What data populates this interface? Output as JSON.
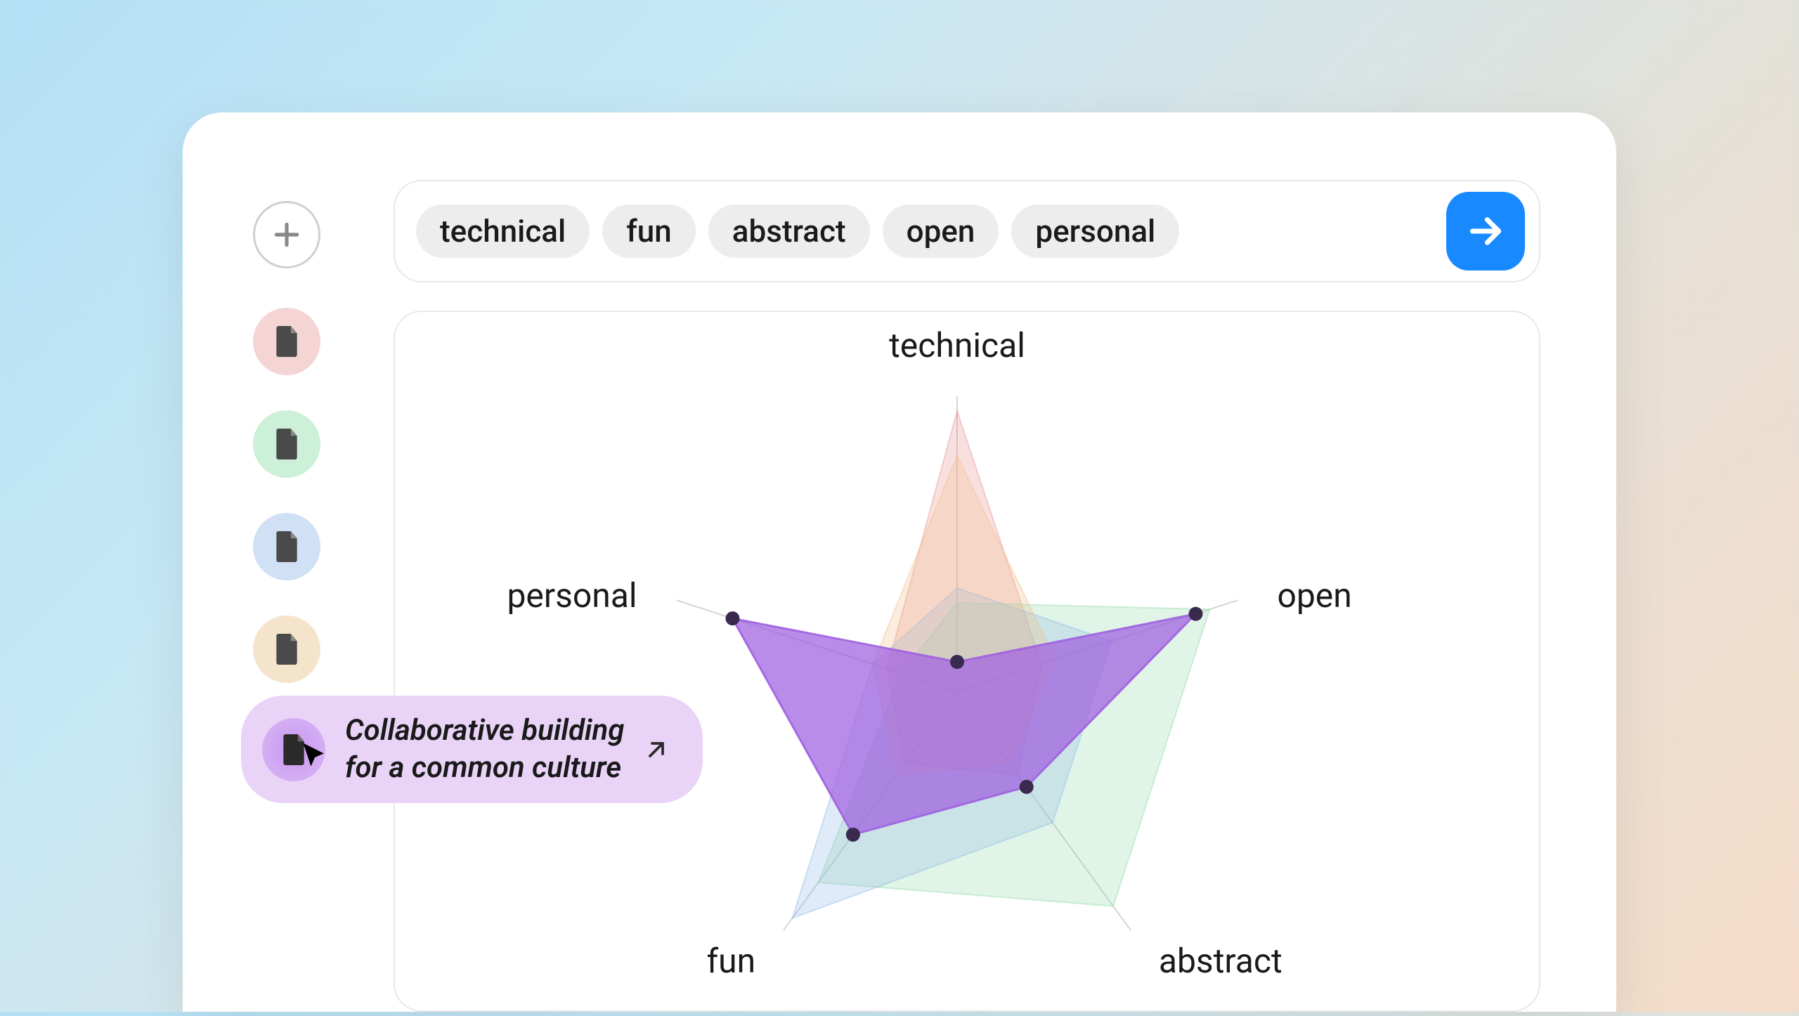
{
  "toolbar": {
    "tags": [
      "technical",
      "fun",
      "abstract",
      "open",
      "personal"
    ]
  },
  "sidebar": {
    "items": [
      {
        "color": "#f5d4d4"
      },
      {
        "color": "#cdf0d9"
      },
      {
        "color": "#d0e0f5"
      },
      {
        "color": "#f5e4cc"
      },
      {
        "color": "#c896f0"
      }
    ],
    "selected_index": 4,
    "tooltip_text": "Collaborative building\nfor a common culture"
  },
  "chart_data": {
    "type": "radar",
    "axes": [
      "technical",
      "open",
      "abstract",
      "fun",
      "personal"
    ],
    "range": [
      0,
      1
    ],
    "series": [
      {
        "name": "red",
        "color": "#e89090",
        "values": [
          0.95,
          0.3,
          0.35,
          0.3,
          0.25
        ]
      },
      {
        "name": "green",
        "color": "#8fd9a8",
        "values": [
          0.3,
          0.9,
          0.9,
          0.8,
          0.2
        ]
      },
      {
        "name": "blue",
        "color": "#8fb8e8",
        "values": [
          0.35,
          0.55,
          0.55,
          0.95,
          0.3
        ]
      },
      {
        "name": "orange",
        "color": "#f0c088",
        "values": [
          0.8,
          0.35,
          0.3,
          0.35,
          0.3
        ]
      },
      {
        "name": "purple",
        "color": "#a060e0",
        "values": [
          0.1,
          0.85,
          0.4,
          0.6,
          0.8
        ],
        "selected": true
      }
    ]
  }
}
